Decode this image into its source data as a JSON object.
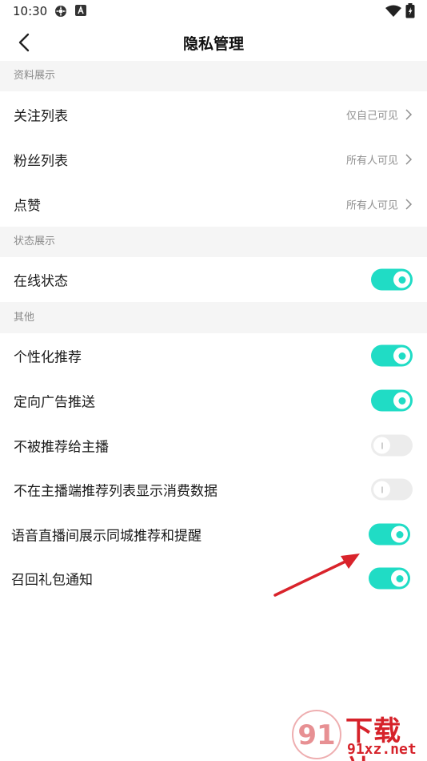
{
  "status_bar": {
    "time": "10:30"
  },
  "header": {
    "title": "隐私管理"
  },
  "sections": [
    {
      "title": "资料展示",
      "rows": [
        {
          "label": "关注列表",
          "value": "仅自己可见"
        },
        {
          "label": "粉丝列表",
          "value": "所有人可见"
        },
        {
          "label": "点赞",
          "value": "所有人可见"
        }
      ]
    },
    {
      "title": "状态展示",
      "rows": [
        {
          "label": "在线状态",
          "toggle": "on"
        }
      ]
    },
    {
      "title": "其他",
      "rows": [
        {
          "label": "个性化推荐",
          "toggle": "on"
        },
        {
          "label": "定向广告推送",
          "toggle": "on"
        },
        {
          "label": "不被推荐给主播",
          "toggle": "off"
        },
        {
          "label": "不在主播端推荐列表显示消费数据",
          "toggle": "off"
        },
        {
          "label": "语音直播间展示同城推荐和提醒",
          "toggle": "on"
        },
        {
          "label": "召回礼包通知",
          "toggle": "on"
        }
      ]
    }
  ],
  "annotation": {
    "arrow_color": "#d9232b"
  },
  "watermark": {
    "brand": "下载站",
    "url": "91xz.net",
    "logo_text": "91"
  },
  "colors": {
    "accent": "#20dcc5",
    "section_bg": "#f5f5f5",
    "watermark": "#d6222a"
  }
}
